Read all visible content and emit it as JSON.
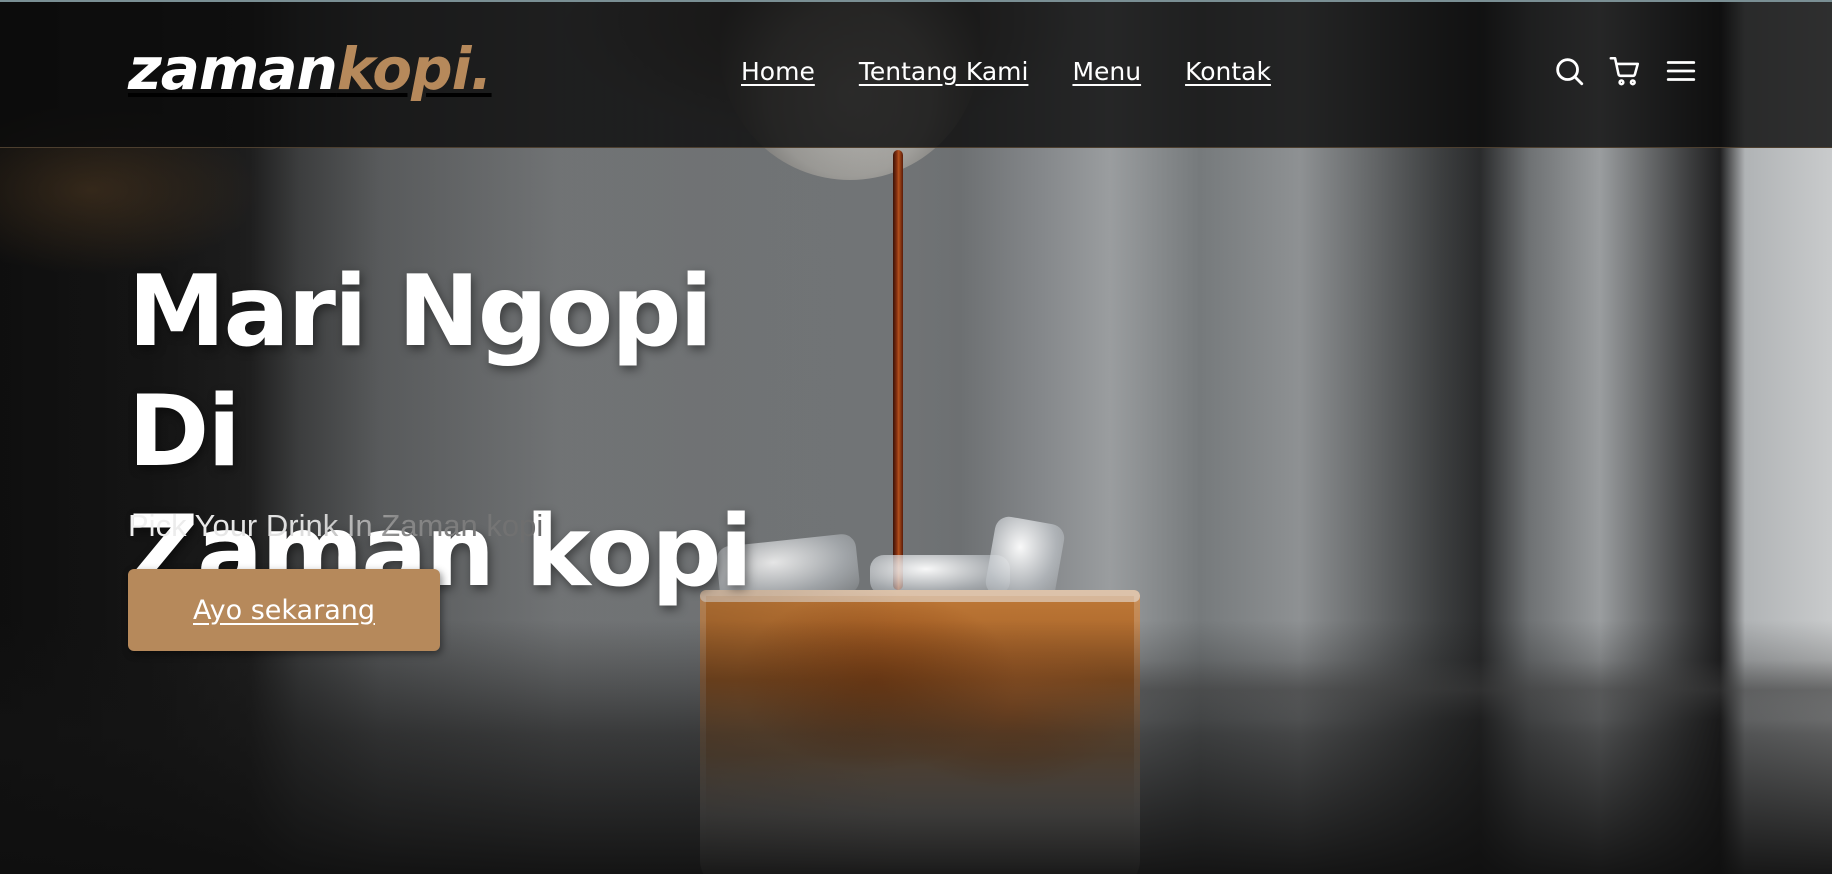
{
  "brand": {
    "logo_part1": "zaman",
    "logo_part2": "kopi.",
    "accent_color": "#b6895b"
  },
  "nav": {
    "items": [
      {
        "label": "Home"
      },
      {
        "label": "Tentang Kami"
      },
      {
        "label": "Menu"
      },
      {
        "label": "Kontak"
      }
    ]
  },
  "header_icons": [
    "search-icon",
    "cart-icon",
    "menu-icon"
  ],
  "hero": {
    "headline_line1": "Mari Ngopi Di",
    "headline_line2": "Zaman kopi",
    "tagline": "Pick Your Drink In Zaman kopi",
    "cta_label": "Ayo sekarang",
    "image": "iced-coffee-pour"
  }
}
